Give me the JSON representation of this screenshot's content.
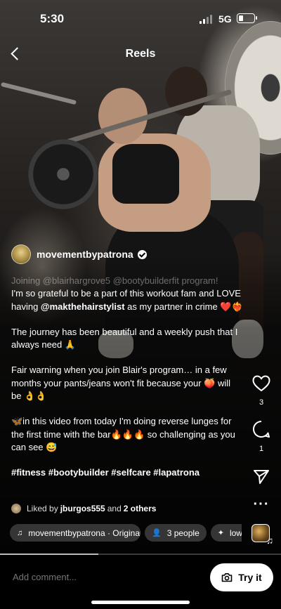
{
  "status_bar": {
    "time": "5:30",
    "network": "5G",
    "battery_level": 0.3
  },
  "header": {
    "title": "Reels"
  },
  "post": {
    "author": "movementbypatrona",
    "caption": {
      "faded_line": "Joining @blairhargrove5 @bootybuilderfit program!",
      "line1_pre": "I'm so grateful to be a part of this workout fam and LOVE having ",
      "line1_mention": "@makthehairstylist",
      "line1_post": " as my partner in crime ❤️❤️‍🔥",
      "para2": "The journey has been beautiful and a weekly push that I always need 🙏",
      "para3": "Fair warning when you join Blair's program… in a few months your pants/jeans won't fit because your 🍑 will be 👌👌",
      "para4": "🦋in this video from today I'm doing reverse lunges for the first time with the bar🔥🔥🔥 so challenging as you can see 😅",
      "hashtags": "#fitness #bootybuilder #selfcare #lapatrona"
    },
    "liked_by": {
      "prefix": "Liked by",
      "user": "jburgos555",
      "and": "and",
      "others": "2 others"
    },
    "chips": {
      "music": "movementbypatrona · Original audio",
      "people": "3 people",
      "effect": "low effort"
    }
  },
  "actions": {
    "likes": "3",
    "comments": "1"
  },
  "icons": {
    "like": "heart-icon",
    "comment": "comment-icon",
    "share": "send-icon",
    "more": "more-icon",
    "back": "chevron-left-icon",
    "camera": "camera-icon"
  },
  "comment_bar": {
    "placeholder": "Add comment...",
    "try_label": "Try it"
  },
  "playback_progress": 0.35
}
